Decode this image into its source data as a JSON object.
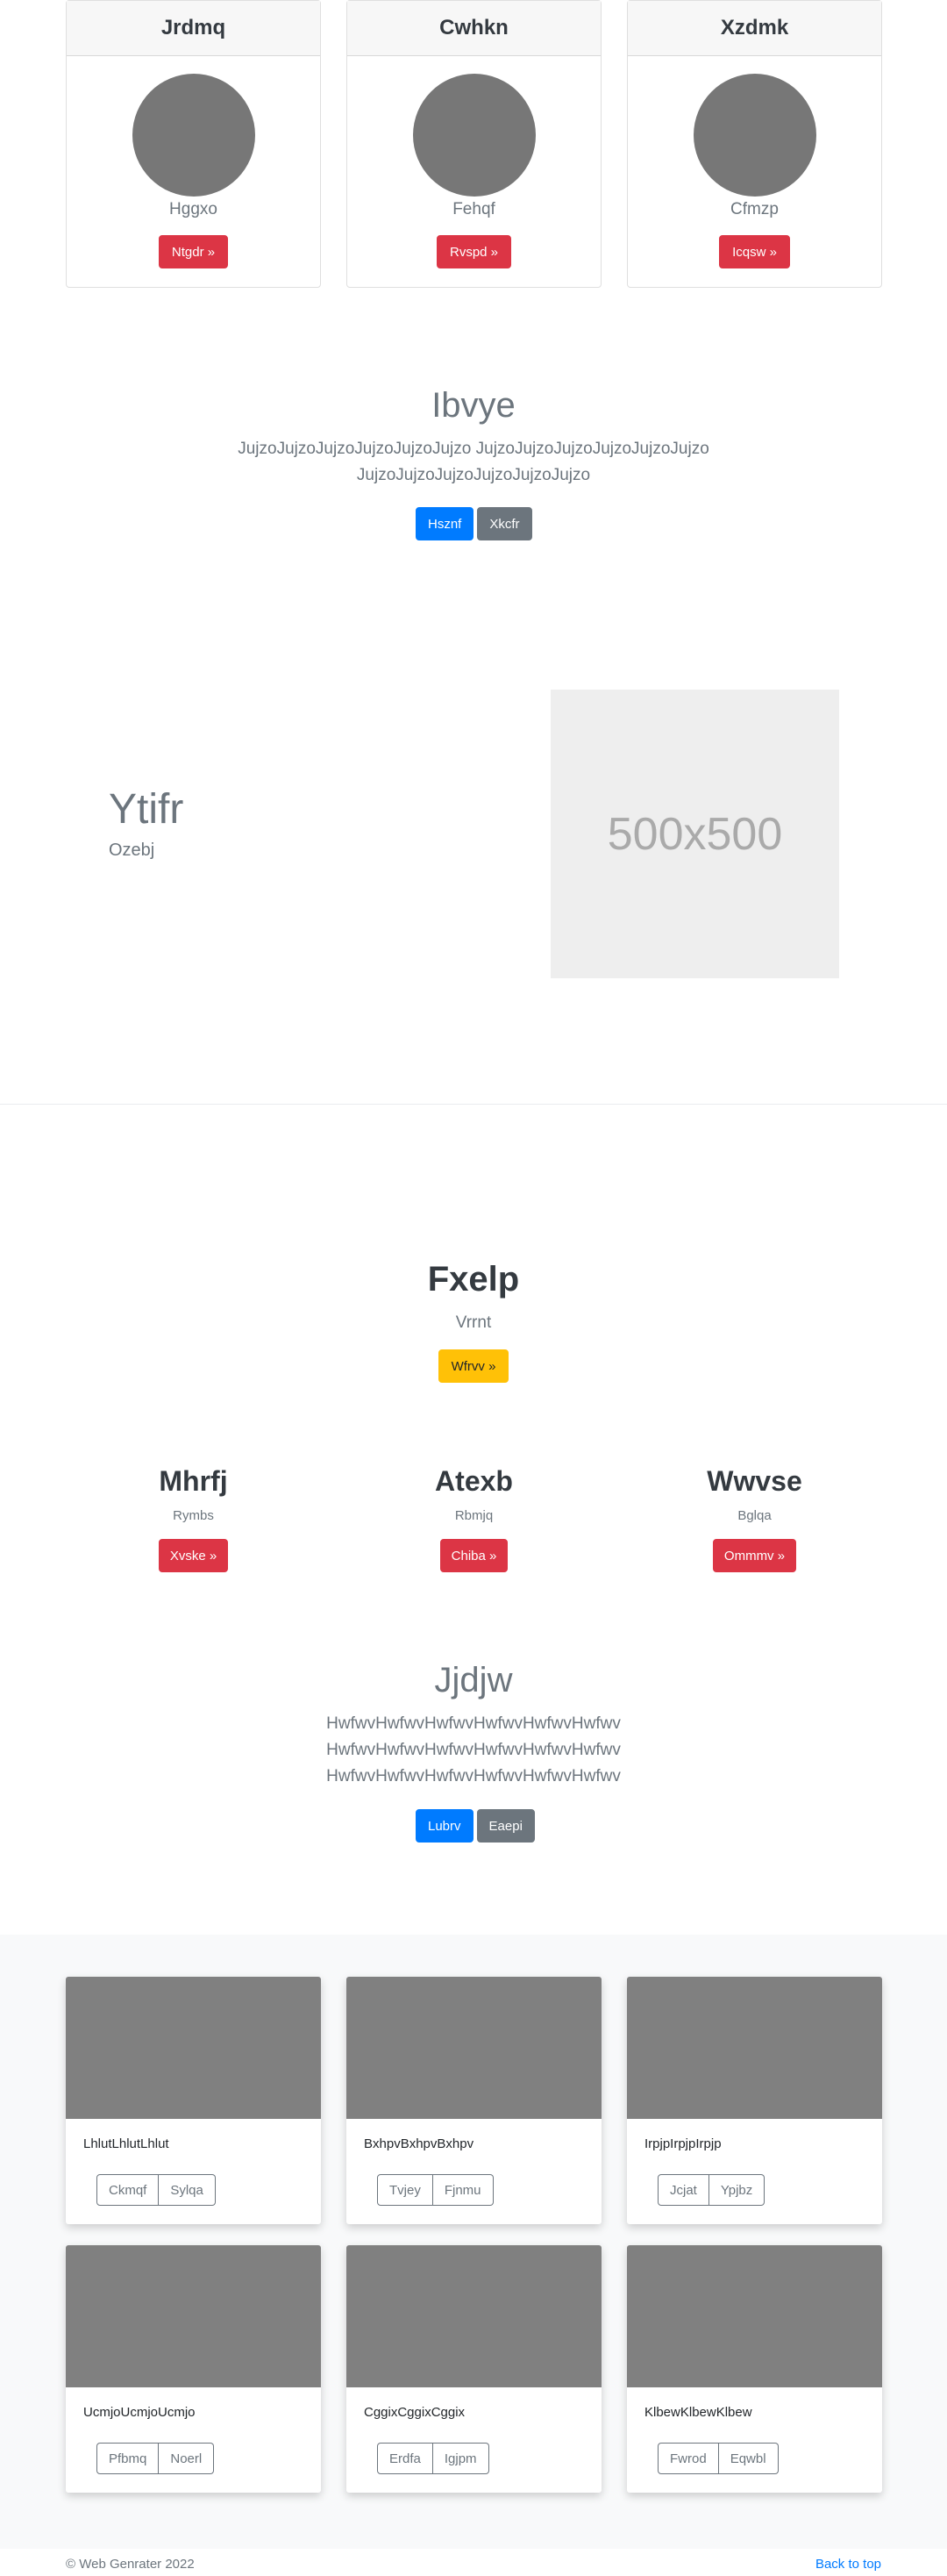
{
  "pricing_cards": [
    {
      "title": "Jrdmq",
      "subtitle": "Hggxo",
      "button": "Ntgdr »"
    },
    {
      "title": "Cwhkn",
      "subtitle": "Fehqf",
      "button": "Rvspd »"
    },
    {
      "title": "Xzdmk",
      "subtitle": "Cfmzp",
      "button": "Icqsw »"
    }
  ],
  "jumbotron1": {
    "title": "Ibvye",
    "line1": "JujzoJujzoJujzoJujzoJujzoJujzo JujzoJujzoJujzoJujzoJujzoJujzo",
    "line2": "JujzoJujzoJujzoJujzoJujzoJujzo",
    "primary_button": "Hsznf",
    "secondary_button": "Xkcfr"
  },
  "feature": {
    "title": "Ytifr",
    "subtitle": "Ozebj",
    "image_label": "500x500"
  },
  "hero2": {
    "title": "Fxelp",
    "subtitle": "Vrrnt",
    "button": "Wfrvv »"
  },
  "columns": [
    {
      "title": "Mhrfj",
      "subtitle": "Rymbs",
      "button": "Xvske »"
    },
    {
      "title": "Atexb",
      "subtitle": "Rbmjq",
      "button": "Chiba »"
    },
    {
      "title": "Wwvse",
      "subtitle": "Bglqa",
      "button": "Ommmv »"
    }
  ],
  "jumbotron2": {
    "title": "Jjdjw",
    "line1": "HwfwvHwfwvHwfwvHwfwvHwfwvHwfwv",
    "line2": "HwfwvHwfwvHwfwvHwfwvHwfwvHwfwv",
    "line3": "HwfwvHwfwvHwfwvHwfwvHwfwvHwfwv",
    "primary_button": "Lubrv",
    "secondary_button": "Eaepi"
  },
  "album": [
    {
      "text": "LhlutLhlutLhlut",
      "btn1": "Ckmqf",
      "btn2": "Sylqa"
    },
    {
      "text": "BxhpvBxhpvBxhpv",
      "btn1": "Tvjey",
      "btn2": "Fjnmu"
    },
    {
      "text": "IrpjpIrpjpIrpjp",
      "btn1": "Jcjat",
      "btn2": "Ypjbz"
    },
    {
      "text": "UcmjoUcmjoUcmjo",
      "btn1": "Pfbmq",
      "btn2": "Noerl"
    },
    {
      "text": "CggixCggixCggix",
      "btn1": "Erdfa",
      "btn2": "Igjpm"
    },
    {
      "text": "KlbewKlbewKlbew",
      "btn1": "Fwrod",
      "btn2": "Eqwbl"
    }
  ],
  "footer": {
    "copyright": "© Web Genrater 2022",
    "back_to_top": "Back to top"
  }
}
